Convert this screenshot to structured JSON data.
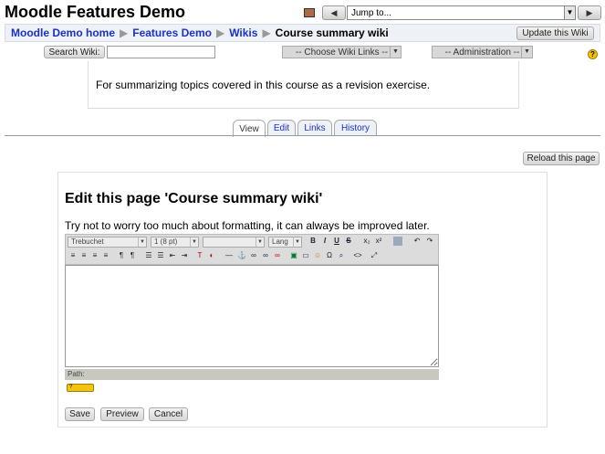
{
  "header": {
    "site_title": "Moodle Features Demo",
    "jump_placeholder": "Jump to..."
  },
  "breadcrumb": [
    "Moodle Demo home",
    "Features Demo",
    "Wikis",
    "Course summary wiki"
  ],
  "update_button": "Update this Wiki",
  "search": {
    "label": "Search Wiki:",
    "value": ""
  },
  "choose_links": "-- Choose Wiki Links --",
  "administration": "-- Administration --",
  "summary": "For summarizing topics covered in this course as a revision exercise.",
  "tabs": [
    "View",
    "Edit",
    "Links",
    "History"
  ],
  "active_tab": "View",
  "reload_button": "Reload this page",
  "edit": {
    "title": "Edit this page 'Course summary wiki'",
    "help": "Try not to worry too much about formatting, it can always be improved later.",
    "font": "Trebuchet",
    "size": "1 (8 pt)",
    "style": "",
    "lang": "Lang",
    "content": "",
    "path_label": "Path:"
  },
  "buttons": {
    "save": "Save",
    "preview": "Preview",
    "cancel": "Cancel"
  }
}
